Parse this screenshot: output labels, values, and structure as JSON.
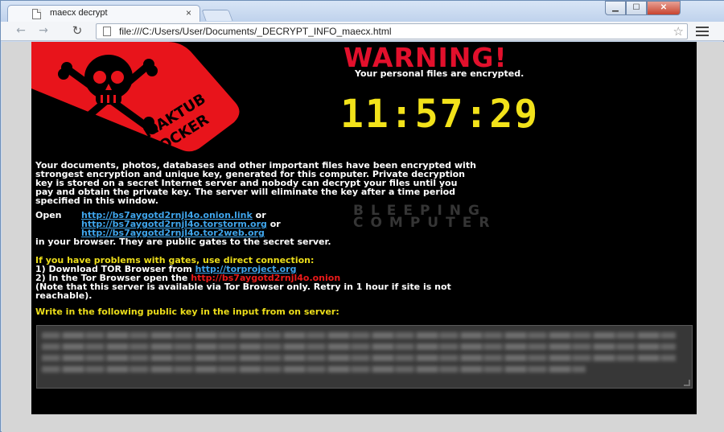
{
  "browser": {
    "tab_title": "maecx decrypt",
    "tab_close": "×",
    "url": "file:///C:/Users/User/Documents/_DECRYPT_INFO_maecx.html",
    "window_controls": {
      "minimize": "▁",
      "maximize": "☐",
      "close": "✕"
    },
    "nav": {
      "back": "←",
      "forward": "→",
      "reload": "↻",
      "star": "☆"
    },
    "icons": [
      "page-icon",
      "back-arrow-icon",
      "forward-arrow-icon",
      "reload-icon",
      "star-icon",
      "menu-icon"
    ]
  },
  "ransom": {
    "logo_text_1": "MAKTUB",
    "logo_text_2": "LOCKER",
    "warning": "WARNING!",
    "warning_sub": "Your personal files are encrypted.",
    "timer": "11:57:29",
    "para_lines": [
      "Your documents, photos, databases and other important files have been encrypted with",
      "strongest encryption and unique key, generated for this computer. Private decryption",
      "key is stored on a secret Internet server and nobody can decrypt your files until you",
      "pay and obtain the private key. The server will eliminate the key after a time period",
      "specified in this window."
    ],
    "open_label": "Open",
    "link1": "http://bs7aygotd2rnjl4o.onion.link",
    "or1": " or",
    "link2": "http://bs7aygotd2rnjl4o.torstorm.org",
    "or2": " or",
    "link3": "http://bs7aygotd2rnjl4o.tor2web.org",
    "links_tail": "in your browser. They are public gates to the secret server.",
    "tor_heading": "If you have problems with gates, use direct connection:",
    "tor_step1_prefix": "1) Download TOR Browser from ",
    "tor_step1_link": "http://torproject.org",
    "tor_step2_prefix": "2) In the Tor Browser open the ",
    "tor_step2_link": "http://bs7aygotd2rnjl4o.onion",
    "tor_note_1": "(Note that this server is available via Tor Browser only. Retry in 1 hour if site is not",
    "tor_note_2": "reachable).",
    "write_heading": "Write in the following public key in the input from on server:",
    "watermark_1": "BLEEPING",
    "watermark_2": "COMPUTER",
    "colors": {
      "background": "#000000",
      "warning": "#e2102c",
      "timer": "#f2e21a",
      "link": "#3fa5ec",
      "heading": "#ecdd1a",
      "onion": "#ea1a1a"
    }
  }
}
